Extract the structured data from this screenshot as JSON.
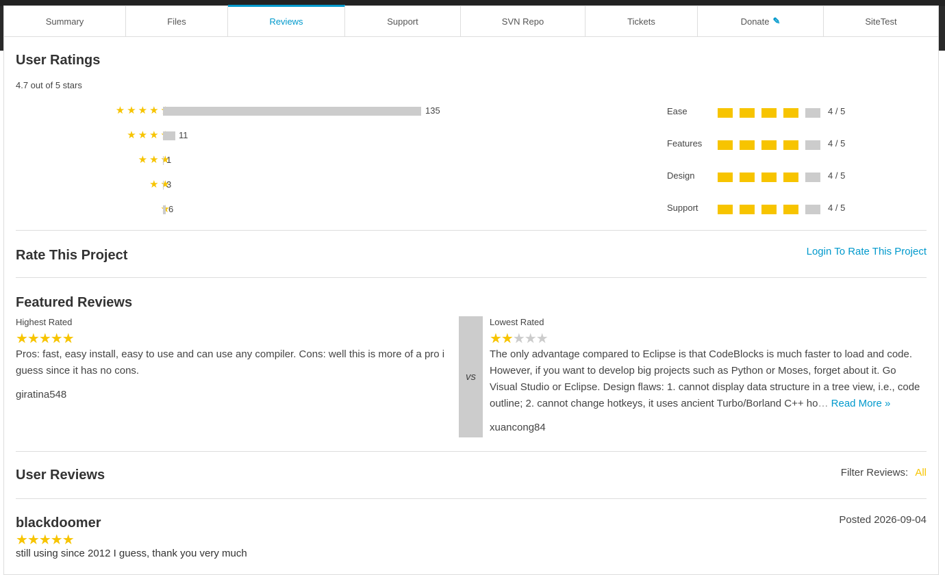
{
  "tabs": [
    {
      "label": "Summary"
    },
    {
      "label": "Files"
    },
    {
      "label": "Reviews"
    },
    {
      "label": "Support"
    },
    {
      "label": "SVN Repo"
    },
    {
      "label": "Tickets"
    },
    {
      "label": "Donate"
    },
    {
      "label": "SiteTest"
    }
  ],
  "ratings": {
    "title": "User Ratings",
    "summary": "4.7 out of 5 stars",
    "distribution": [
      {
        "stars": 5,
        "count": "135"
      },
      {
        "stars": 4,
        "count": "11"
      },
      {
        "stars": 3,
        "count": "1"
      },
      {
        "stars": 2,
        "count": "3"
      },
      {
        "stars": 1,
        "count": "6"
      }
    ],
    "categories": [
      {
        "label": "Ease",
        "score": "4 / 5"
      },
      {
        "label": "Features",
        "score": "4 / 5"
      },
      {
        "label": "Design",
        "score": "4 / 5"
      },
      {
        "label": "Support",
        "score": "4 / 5"
      }
    ]
  },
  "rate": {
    "title": "Rate This Project",
    "login_link": "Login To Rate This Project"
  },
  "featured": {
    "title": "Featured Reviews",
    "vs_label": "vs",
    "highest": {
      "label": "Highest Rated",
      "rating": 5,
      "text": "Pros: fast, easy install, easy to use and can use any compiler. Cons: well this is more of a pro i guess since it has no cons.",
      "user": "giratina548"
    },
    "lowest": {
      "label": "Lowest Rated",
      "rating": 2,
      "text": "The only advantage compared to Eclipse is that CodeBlocks is much faster to load and code. However, if you want to develop big projects such as Python or Moses, forget about it. Go Visual Studio or Eclipse. Design flaws: 1. cannot display data structure in a tree view, i.e., code outline; 2. cannot change hotkeys, it uses ancient Turbo/Borland C++ ho",
      "ellipsis": "…",
      "read_more": "Read More »",
      "user": "xuancong84"
    }
  },
  "user_reviews": {
    "title": "User Reviews",
    "filter_label": "Filter Reviews:",
    "filter_value": "All",
    "items": [
      {
        "user": "blackdoomer",
        "rating": 5,
        "posted_label": "Posted",
        "posted_date": "2026-09-04",
        "text": "still using since 2012 I guess, thank you very much"
      }
    ]
  },
  "colors": {
    "accent": "#0099cc",
    "star": "#f7c400",
    "bar": "#cccccc"
  }
}
